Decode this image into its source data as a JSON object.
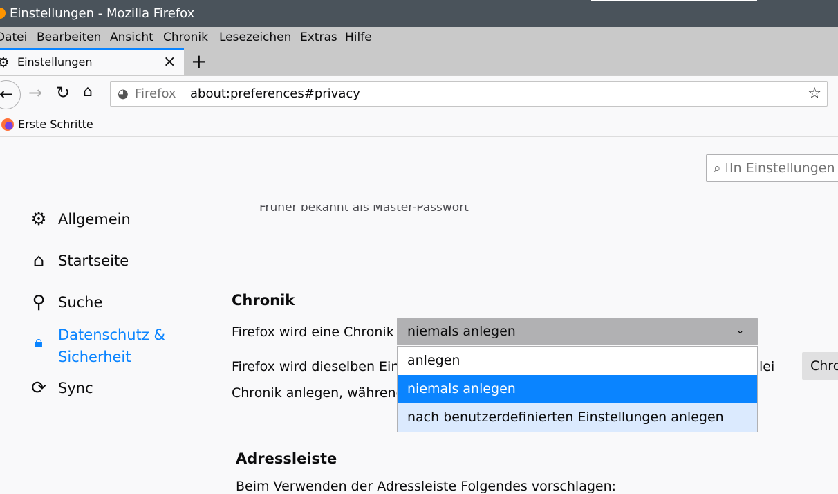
{
  "window": {
    "title": "Einstellungen - Mozilla Firefox"
  },
  "menu": [
    "Datei",
    "Bearbeiten",
    "Ansicht",
    "Chronik",
    "Lesezeichen",
    "Extras",
    "Hilfe"
  ],
  "tab": {
    "label": "Einstellungen",
    "close": "×",
    "new_tab": "+"
  },
  "nav": {
    "identity": "Firefox",
    "url": "about:preferences#privacy"
  },
  "bookmarks": [
    {
      "label": "Erste Schritte"
    }
  ],
  "search": {
    "placeholder": "In Einstellungen suchen",
    "visible": "⌕ In Einstellungen s"
  },
  "sidebar": {
    "items": [
      {
        "label": "Allgemein",
        "icon": "gear-icon"
      },
      {
        "label": "Startseite",
        "icon": "home-icon"
      },
      {
        "label": "Suche",
        "icon": "search-icon"
      },
      {
        "label": "Datenschutz &",
        "label2": "Sicherheit",
        "icon": "lock-icon",
        "active": true
      },
      {
        "label": "Sync",
        "icon": "sync-icon"
      }
    ]
  },
  "main": {
    "prev_note": "Früher bekannt als Master-Passwort",
    "history": {
      "heading": "Chronik",
      "label": "Firefox wird eine Chronik",
      "selected": "niemals anlegen",
      "options": [
        "anlegen",
        "niemals anlegen",
        "nach benutzerdefinierten Einstellungen anlegen"
      ],
      "desc1": "Firefox wird dieselben Eins",
      "desc1_end": "lei",
      "desc2": "Chronik anlegen, während",
      "clear_button": "Chro"
    },
    "addressbar": {
      "heading": "Adressleiste",
      "desc": "Beim Verwenden der Adressleiste Folgendes vorschlagen:"
    }
  },
  "colors": {
    "accent": "#0a84ff",
    "titlebar": "#4a535b",
    "hover": "#dbeafe"
  }
}
